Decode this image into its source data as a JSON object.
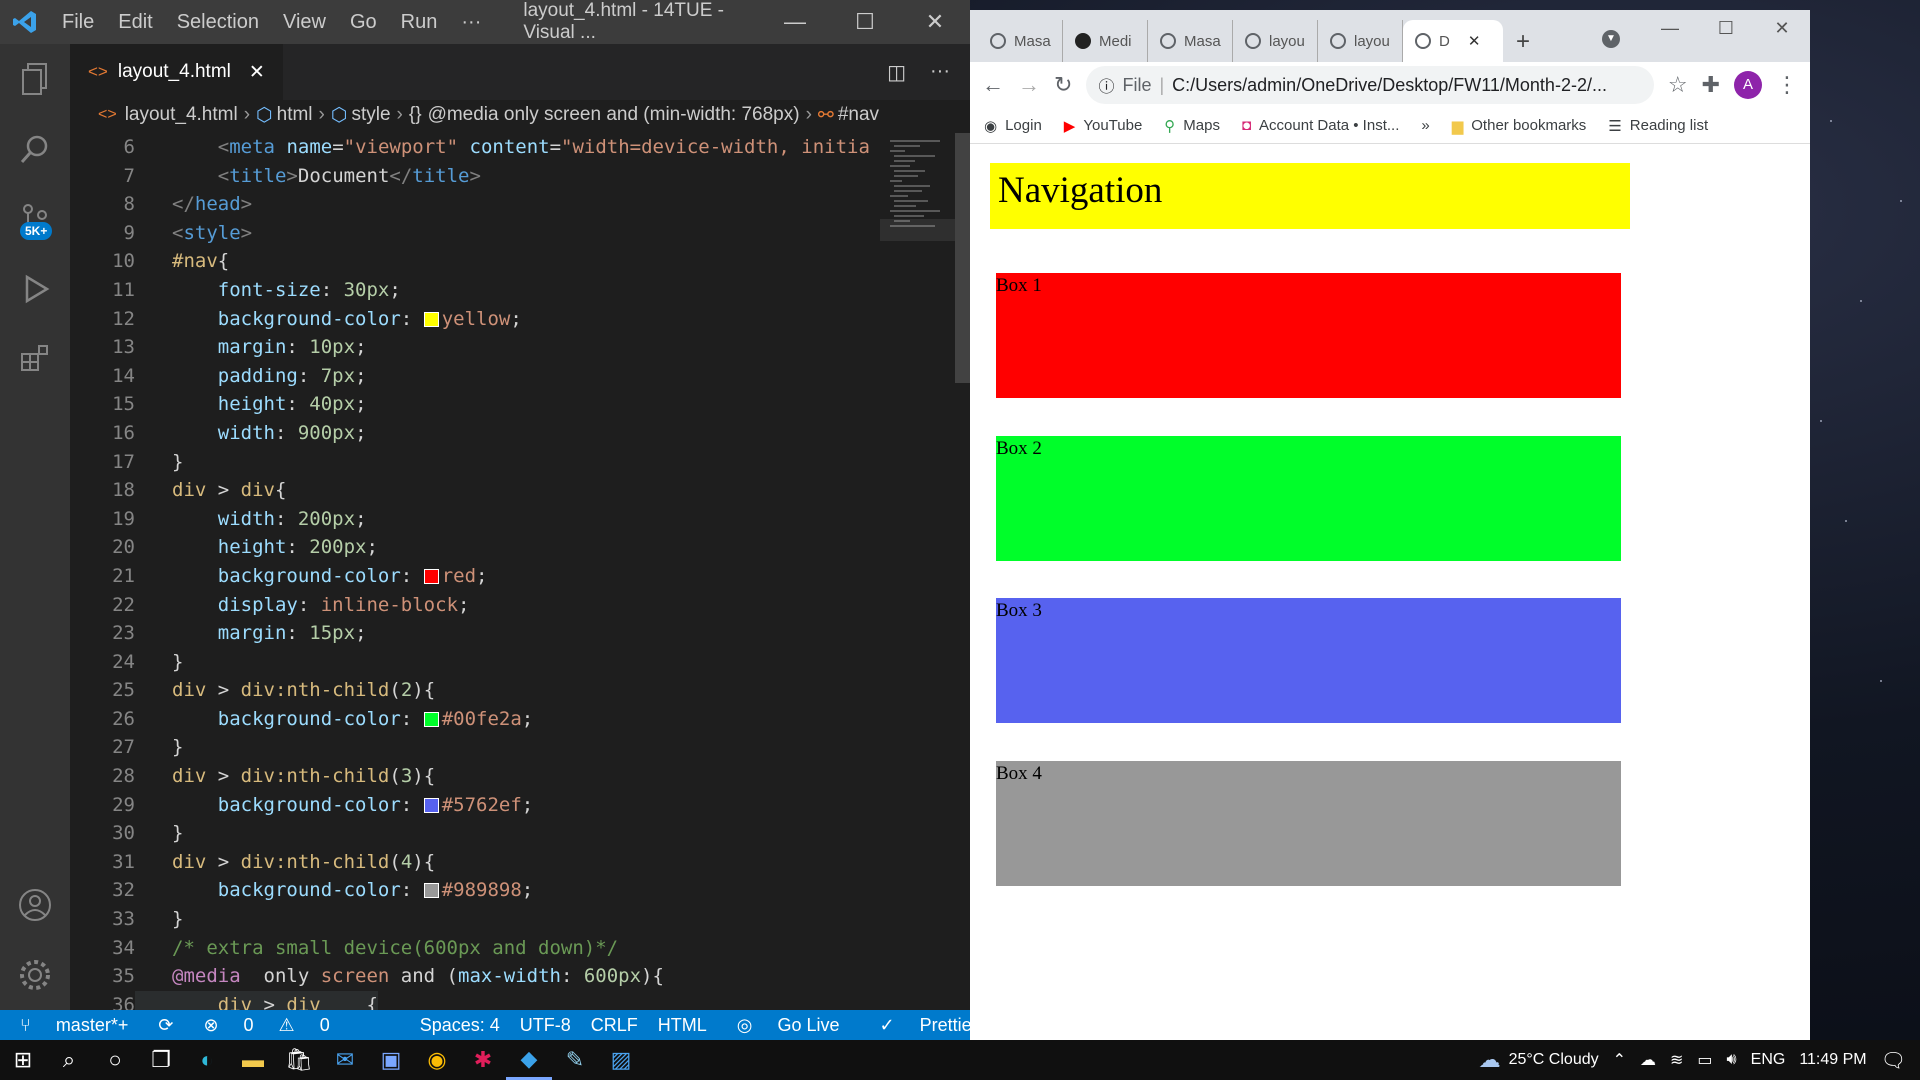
{
  "vscode": {
    "menu": [
      "File",
      "Edit",
      "Selection",
      "View",
      "Go",
      "Run",
      "···"
    ],
    "window_title": "layout_4.html - 14TUE - Visual ...",
    "tab_label": "layout_4.html",
    "scm_badge": "5K+",
    "breadcrumb": [
      "layout_4.html",
      "html",
      "style",
      "@media only screen and (min-width: 768px)",
      "#nav"
    ],
    "status": {
      "branch": "master*+",
      "problems": "0",
      "warnings": "0",
      "spaces": "Spaces: 4",
      "encoding": "UTF-8",
      "eol": "CRLF",
      "language": "HTML",
      "golive": "Go Live",
      "prettier": "Prettier"
    },
    "line_numbers": [
      "6",
      "7",
      "8",
      "9",
      "10",
      "11",
      "12",
      "13",
      "14",
      "15",
      "16",
      "17",
      "18",
      "19",
      "20",
      "21",
      "22",
      "23",
      "24",
      "25",
      "26",
      "27",
      "28",
      "29",
      "30",
      "31",
      "32",
      "33",
      "34",
      "35",
      "36"
    ],
    "swatch_colors": {
      "yellow": "#ffff00",
      "red": "#ff0000",
      "green": "#00fe2a",
      "blue": "#5762ef",
      "gray": "#989898"
    }
  },
  "chrome": {
    "tabs": [
      "Masa",
      "Medi",
      "Masa",
      "layou",
      "layou",
      "D"
    ],
    "url_scheme": "File",
    "url": "C:/Users/admin/OneDrive/Desktop/FW11/Month-2-2/...",
    "avatar_letter": "A",
    "bookmarks": [
      "Login",
      "YouTube",
      "Maps",
      "Account Data • Inst...",
      "»",
      "Other bookmarks",
      "Reading list"
    ],
    "page": {
      "nav_title": "Navigation",
      "boxes": [
        {
          "label": "Box 1",
          "color": "#ff0000"
        },
        {
          "label": "Box 2",
          "color": "#00fe2a"
        },
        {
          "label": "Box 3",
          "color": "#5762ef"
        },
        {
          "label": "Box 4",
          "color": "#989898"
        }
      ]
    }
  },
  "taskbar": {
    "weather": "25°C  Cloudy",
    "lang": "ENG",
    "time": "11:49 PM"
  }
}
